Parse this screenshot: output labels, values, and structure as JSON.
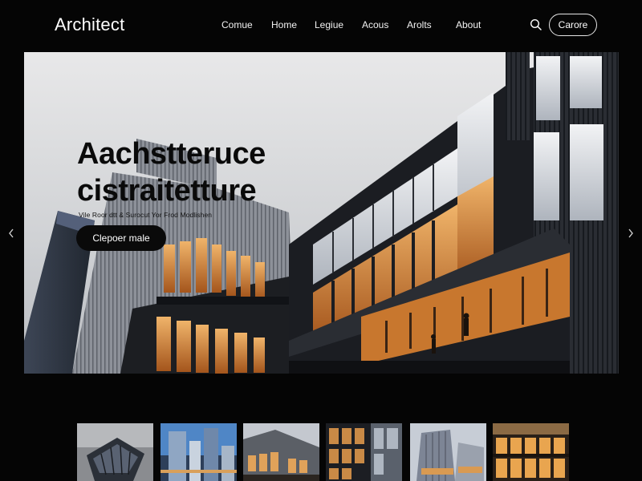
{
  "header": {
    "brand": "Architect",
    "nav": [
      "Comue",
      "Home",
      "Legiue",
      "Acous",
      "Arolts",
      "About"
    ],
    "cta_label": "Carore"
  },
  "hero": {
    "title_line1": "Aachstteruce",
    "title_line2": "cistraitetture",
    "subtitle": "Vile Roor dtt & Surocut Yor Frod Modlishen",
    "button_label": "Clepoer male"
  },
  "icons": {
    "search": "search-icon",
    "prev": "chevron-left-icon",
    "next": "chevron-right-icon"
  },
  "colors": {
    "background": "#050505",
    "hero_sky": "#d9dadc",
    "facade_dark": "#1b1d22",
    "window_glow": "#e39a4c"
  },
  "thumbnails": [
    {
      "label": "building-thumbnail-1"
    },
    {
      "label": "building-thumbnail-2"
    },
    {
      "label": "building-thumbnail-3"
    },
    {
      "label": "building-thumbnail-4"
    },
    {
      "label": "building-thumbnail-5"
    },
    {
      "label": "building-thumbnail-6"
    }
  ]
}
